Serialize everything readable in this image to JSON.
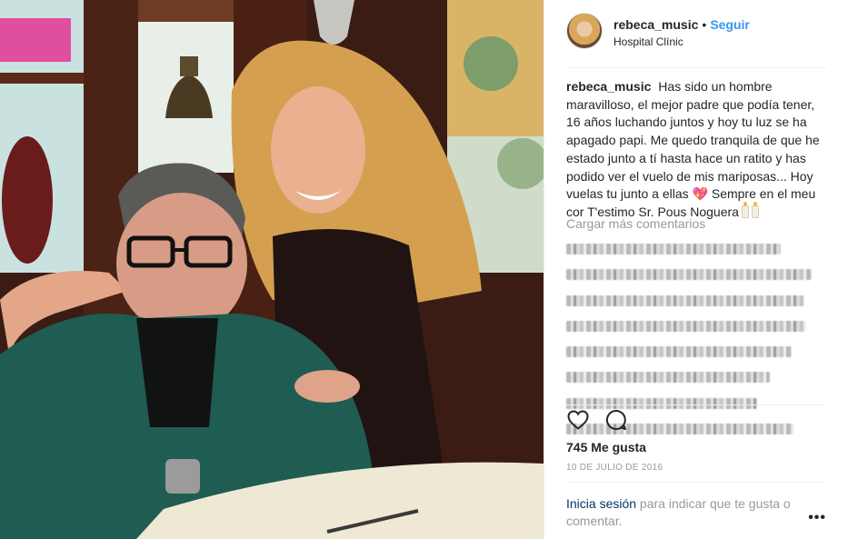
{
  "post": {
    "username": "rebeca_music",
    "separator": "•",
    "follow_label": "Seguir",
    "location": "Hospital Clínic",
    "caption": {
      "username": "rebeca_music",
      "text_1": "Has sido un hombre maravilloso, el mejor padre que podía tener, 16 años luchando juntos y hoy tu luz se ha apagado papi. Me quedo tranquila de que he estado junto a tí hasta hace un ratito y has podido ver el vuelo de mis mariposas... Hoy vuelas tu junto a ellas",
      "emoji_heart": "💖",
      "text_2": "Sempre en el meu cor T'estimo Sr. Pous Noguera"
    },
    "load_more_label": "Cargar más comentarios",
    "likes_label": "745 Me gusta",
    "date_label": "10 DE JULIO DE 2016",
    "login_link_label": "Inicia sesión",
    "login_text": " para indicar que te gusta o comentar.",
    "more_label": "•••"
  },
  "icons": {
    "like": "heart-icon",
    "comment": "comment-icon",
    "options": "more-options-icon"
  },
  "colors": {
    "link_blue": "#3897f0",
    "dark_link": "#003569",
    "muted": "#999999",
    "text": "#262626"
  }
}
